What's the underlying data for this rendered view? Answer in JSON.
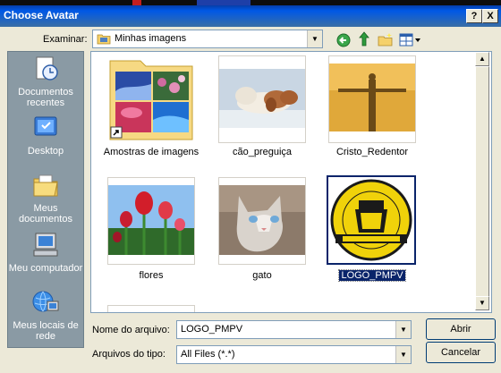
{
  "window": {
    "title": "Choose Avatar",
    "help": "?",
    "close": "X"
  },
  "lookin": {
    "label": "Examinar:",
    "value": "Minhas imagens"
  },
  "places": [
    {
      "name": "recent",
      "label": "Documentos recentes",
      "icon": "recent-documents-icon"
    },
    {
      "name": "desktop",
      "label": "Desktop",
      "icon": "desktop-icon"
    },
    {
      "name": "mydocs",
      "label": "Meus documentos",
      "icon": "my-documents-icon"
    },
    {
      "name": "mycomputer",
      "label": "Meu computador",
      "icon": "my-computer-icon"
    },
    {
      "name": "network",
      "label": "Meus locais de rede",
      "icon": "network-places-icon"
    }
  ],
  "files": [
    {
      "name": "Amostras de imagens",
      "type": "folder"
    },
    {
      "name": "cão_preguiça",
      "type": "image"
    },
    {
      "name": "Cristo_Redentor",
      "type": "image"
    },
    {
      "name": "flores",
      "type": "image"
    },
    {
      "name": "gato",
      "type": "image"
    },
    {
      "name": "LOGO_PMPV",
      "type": "image",
      "selected": true
    }
  ],
  "filename": {
    "label": "Nome do arquivo:",
    "value": "LOGO_PMPV"
  },
  "filetype": {
    "label": "Arquivos do tipo:",
    "value": "All Files (*.*)"
  },
  "buttons": {
    "open": "Abrir",
    "cancel": "Cancelar"
  },
  "colors": {
    "titlebar": "#0058e6",
    "selection": "#0a246a",
    "dialog": "#ECE9D8"
  }
}
